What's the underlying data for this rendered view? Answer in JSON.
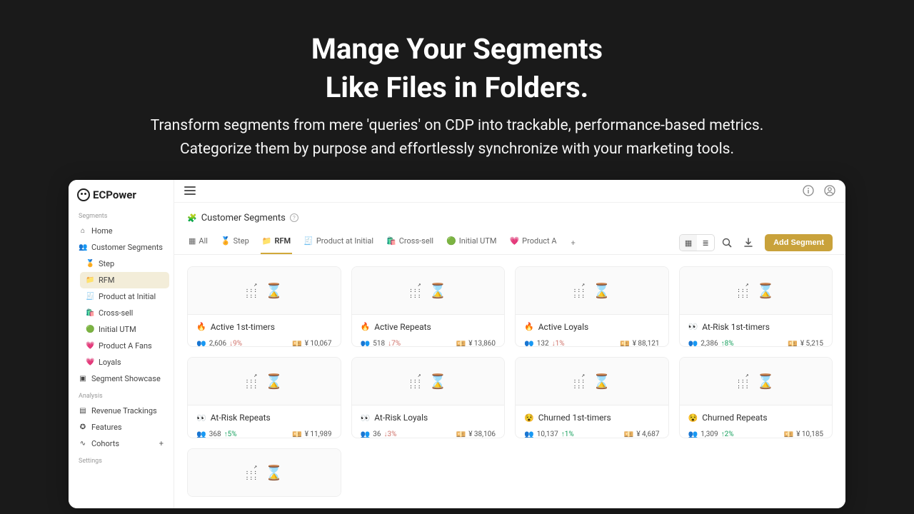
{
  "hero": {
    "title_line1": "Mange Your Segments",
    "title_line2": "Like Files in Folders.",
    "sub_line1": "Transform segments from mere 'queries' on CDP into trackable, performance-based metrics.",
    "sub_line2": "Categorize them by purpose and effortlessly synchronize with your marketing tools."
  },
  "brand": "ECPower",
  "sidebar": {
    "sections": {
      "segments_label": "Segments",
      "analysis_label": "Analysis",
      "settings_label": "Settings"
    },
    "home": "Home",
    "customer_segments": "Customer Segments",
    "folders": [
      {
        "icon": "🏅",
        "label": "Step"
      },
      {
        "icon": "📁",
        "label": "RFM",
        "active": true
      },
      {
        "icon": "🧾",
        "label": "Product at Initial"
      },
      {
        "icon": "🛍️",
        "label": "Cross-sell"
      },
      {
        "icon": "🟢",
        "label": "Initial UTM"
      },
      {
        "icon": "💗",
        "label": "Product A Fans"
      },
      {
        "icon": "💗",
        "label": "Loyals"
      }
    ],
    "segment_showcase": "Segment Showcase",
    "revenue_trackings": "Revenue Trackings",
    "features": "Features",
    "cohorts": "Cohorts"
  },
  "breadcrumb": {
    "icon": "🧩",
    "label": "Customer Segments"
  },
  "tabs": [
    {
      "icon": "▦",
      "label": "All"
    },
    {
      "icon": "🏅",
      "label": "Step"
    },
    {
      "icon": "📁",
      "label": "RFM",
      "active": true
    },
    {
      "icon": "🧾",
      "label": "Product at Initial"
    },
    {
      "icon": "🛍️",
      "label": "Cross-sell"
    },
    {
      "icon": "🟢",
      "label": "Initial UTM"
    },
    {
      "icon": "💗",
      "label": "Product A"
    }
  ],
  "actions": {
    "add_segment": "Add Segment"
  },
  "cards": [
    {
      "emoji": "🔥",
      "title": "Active 1st-timers",
      "people": "2,606",
      "delta": "9%",
      "dir": "down",
      "revenue": "¥ 10,067"
    },
    {
      "emoji": "🔥",
      "title": "Active Repeats",
      "people": "518",
      "delta": "7%",
      "dir": "down",
      "revenue": "¥ 13,860"
    },
    {
      "emoji": "🔥",
      "title": "Active Loyals",
      "people": "132",
      "delta": "1%",
      "dir": "down",
      "revenue": "¥ 88,121"
    },
    {
      "emoji": "👀",
      "title": "At-Risk 1st-timers",
      "people": "2,386",
      "delta": "8%",
      "dir": "up",
      "revenue": "¥ 5,215"
    },
    {
      "emoji": "👀",
      "title": "At-Risk Repeats",
      "people": "368",
      "delta": "5%",
      "dir": "up",
      "revenue": "¥ 11,989"
    },
    {
      "emoji": "👀",
      "title": "At-Risk Loyals",
      "people": "36",
      "delta": "3%",
      "dir": "down",
      "revenue": "¥ 38,106"
    },
    {
      "emoji": "😵",
      "title": "Churned 1st-timers",
      "people": "10,137",
      "delta": "1%",
      "dir": "up",
      "revenue": "¥ 4,687"
    },
    {
      "emoji": "😵",
      "title": "Churned Repeats",
      "people": "1,309",
      "delta": "2%",
      "dir": "up",
      "revenue": "¥ 10,185"
    }
  ]
}
